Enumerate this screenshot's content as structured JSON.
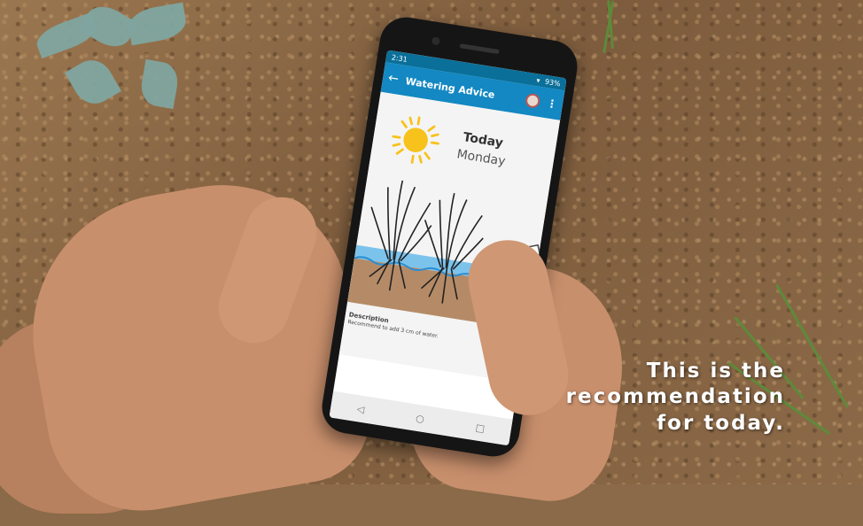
{
  "phone": {
    "status_time": "2:31",
    "battery": "93%",
    "app_title": "Watering Advice",
    "back_icon": "arrow-left-icon",
    "menu_icon": "more-vert-icon",
    "day_label": "Today",
    "day_name": "Monday",
    "description_title": "Description",
    "description_text": "Recommend to add 3 cm of water.",
    "nav": {
      "back": "◁",
      "home": "○",
      "recent": "□"
    }
  },
  "caption": {
    "line1": "This is the",
    "line2": "recommendation",
    "line3": "for today."
  },
  "colors": {
    "status_bar": "#0a6f99",
    "app_bar": "#1388c2",
    "sun": "#f7c21b",
    "water": "#2a8fd4",
    "soil": "#b58b67"
  }
}
